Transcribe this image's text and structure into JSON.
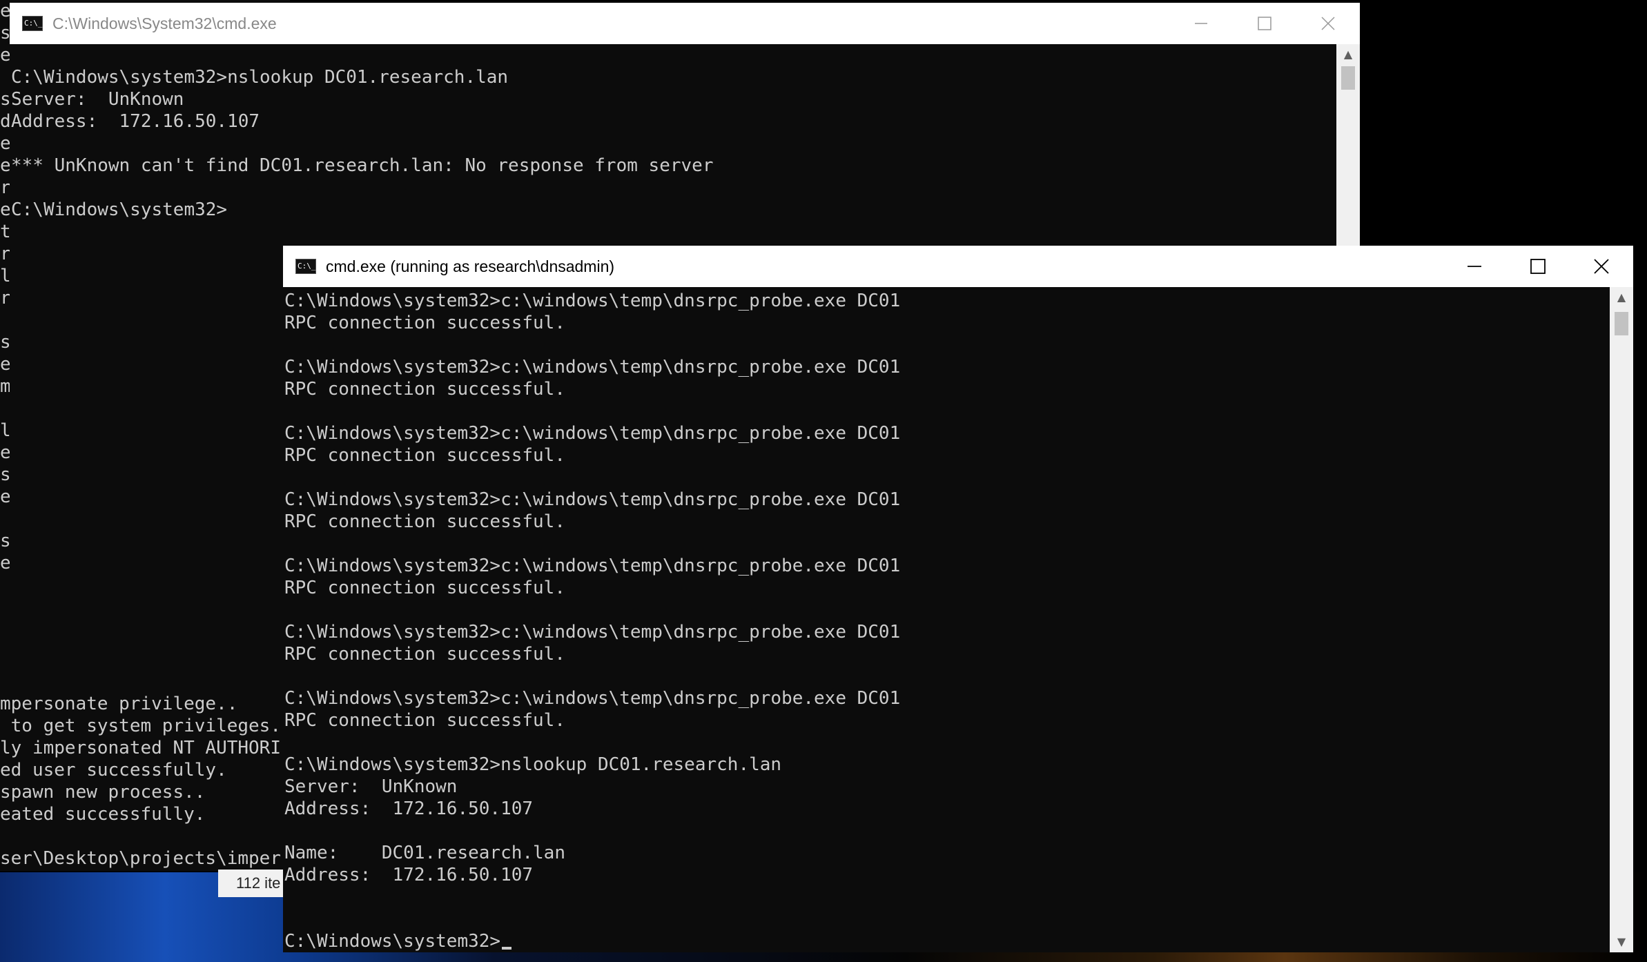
{
  "back_console": {
    "lines": [
      "mpersonate privilege..",
      " to get system privileges.",
      "ly impersonated NT AUTHORI",
      "ed user successfully.",
      "spawn new process..",
      "eated successfully.",
      "",
      "ser\\Desktop\\projects\\imper"
    ],
    "edge_chars": [
      "e",
      "s",
      "e",
      "",
      "s",
      "d",
      "e",
      "e",
      "r",
      "e",
      "t",
      "r",
      "l",
      "r",
      "",
      "s",
      "e",
      "m",
      "",
      "l",
      "e",
      "s",
      "e",
      "",
      "s",
      "e"
    ]
  },
  "explorer": {
    "status_text": "112 ite"
  },
  "window1": {
    "title": "C:\\Windows\\System32\\cmd.exe",
    "lines": [
      "",
      "C:\\Windows\\system32>nslookup DC01.research.lan",
      "Server:  UnKnown",
      "Address:  172.16.50.107",
      "",
      "*** UnKnown can't find DC01.research.lan: No response from server",
      "",
      "C:\\Windows\\system32>"
    ]
  },
  "window2": {
    "title": "cmd.exe (running as research\\dnsadmin)",
    "lines": [
      "C:\\Windows\\system32>c:\\windows\\temp\\dnsrpc_probe.exe DC01",
      "RPC connection successful.",
      "",
      "C:\\Windows\\system32>c:\\windows\\temp\\dnsrpc_probe.exe DC01",
      "RPC connection successful.",
      "",
      "C:\\Windows\\system32>c:\\windows\\temp\\dnsrpc_probe.exe DC01",
      "RPC connection successful.",
      "",
      "C:\\Windows\\system32>c:\\windows\\temp\\dnsrpc_probe.exe DC01",
      "RPC connection successful.",
      "",
      "C:\\Windows\\system32>c:\\windows\\temp\\dnsrpc_probe.exe DC01",
      "RPC connection successful.",
      "",
      "C:\\Windows\\system32>c:\\windows\\temp\\dnsrpc_probe.exe DC01",
      "RPC connection successful.",
      "",
      "C:\\Windows\\system32>c:\\windows\\temp\\dnsrpc_probe.exe DC01",
      "RPC connection successful.",
      "",
      "C:\\Windows\\system32>nslookup DC01.research.lan",
      "Server:  UnKnown",
      "Address:  172.16.50.107",
      "",
      "Name:    DC01.research.lan",
      "Address:  172.16.50.107",
      "",
      ""
    ],
    "prompt": "C:\\Windows\\system32>"
  }
}
